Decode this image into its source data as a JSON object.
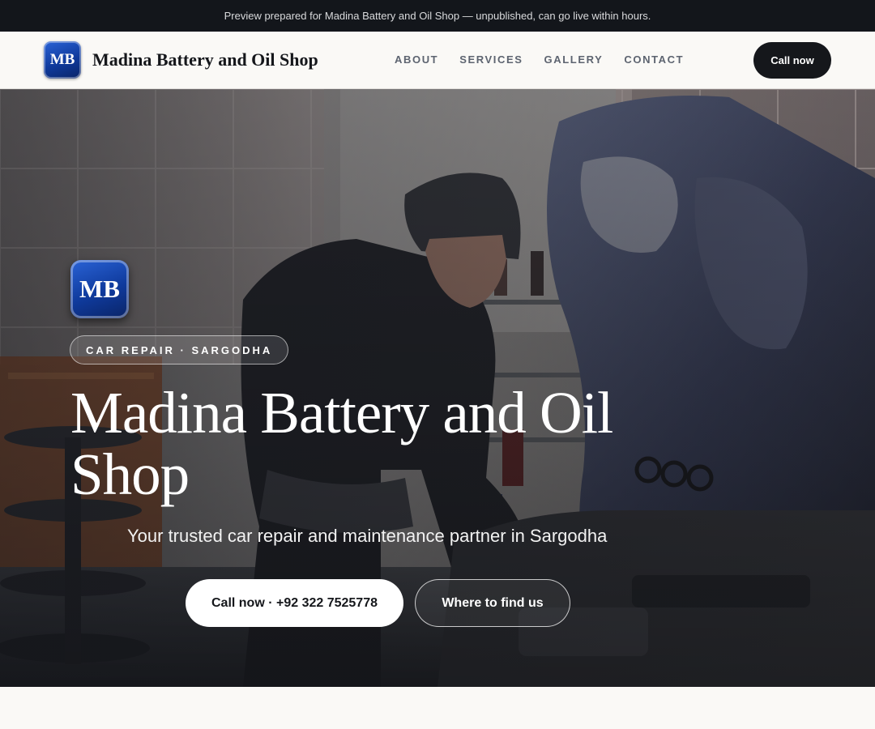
{
  "banner": {
    "text": "Preview prepared for Madina Battery and Oil Shop — unpublished, can go live within hours."
  },
  "header": {
    "logo_text": "MB",
    "brand_name": "Madina Battery and Oil Shop",
    "nav": [
      "ABOUT",
      "SERVICES",
      "GALLERY",
      "CONTACT"
    ],
    "call_button": "Call now"
  },
  "hero": {
    "logo_text": "MB",
    "tag": "CAR REPAIR · SARGODHA",
    "title": "Madina Battery and Oil Shop",
    "subtitle": "Your trusted car repair and maintenance partner in Sargodha",
    "primary_button": "Call now · +92 322 7525778",
    "secondary_button": "Where to find us"
  },
  "colors": {
    "banner_bg": "#13161b",
    "header_bg": "#faf9f6",
    "dark": "#15171b",
    "logo_blue": "#1a4bb5"
  }
}
